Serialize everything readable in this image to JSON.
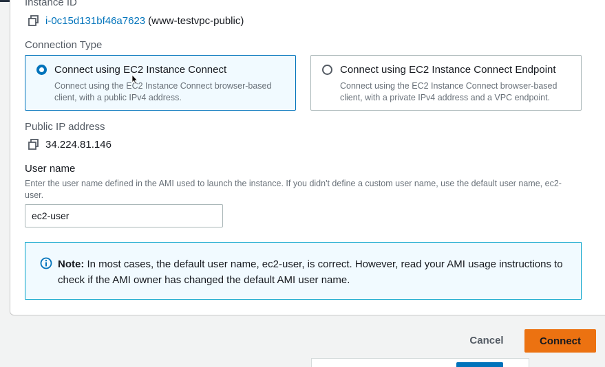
{
  "instance": {
    "label": "Instance ID",
    "id": "i-0c15d131bf46a7623",
    "name": "(www-testvpc-public)"
  },
  "connection_type": {
    "label": "Connection Type",
    "options": [
      {
        "title": "Connect using EC2 Instance Connect",
        "description": "Connect using the EC2 Instance Connect browser-based client, with a public IPv4 address.",
        "selected": true
      },
      {
        "title": "Connect using EC2 Instance Connect Endpoint",
        "description": "Connect using the EC2 Instance Connect browser-based client, with a private IPv4 address and a VPC endpoint.",
        "selected": false
      }
    ]
  },
  "public_ip": {
    "label": "Public IP address",
    "value": "34.224.81.146"
  },
  "username": {
    "label": "User name",
    "hint": "Enter the user name defined in the AMI used to launch the instance. If you didn't define a custom user name, use the default user name, ec2-user.",
    "value": "ec2-user"
  },
  "note": {
    "prefix": "Note:",
    "text": " In most cases, the default user name, ec2-user, is correct. However, read your AMI usage instructions to check if the AMI owner has changed the default AMI user name."
  },
  "actions": {
    "cancel": "Cancel",
    "connect": "Connect"
  },
  "colors": {
    "accent": "#0073bb",
    "primary_button": "#ec7211",
    "info_border": "#00a1c9"
  },
  "icons": {
    "copy": "copy-icon",
    "info": "info-icon"
  }
}
